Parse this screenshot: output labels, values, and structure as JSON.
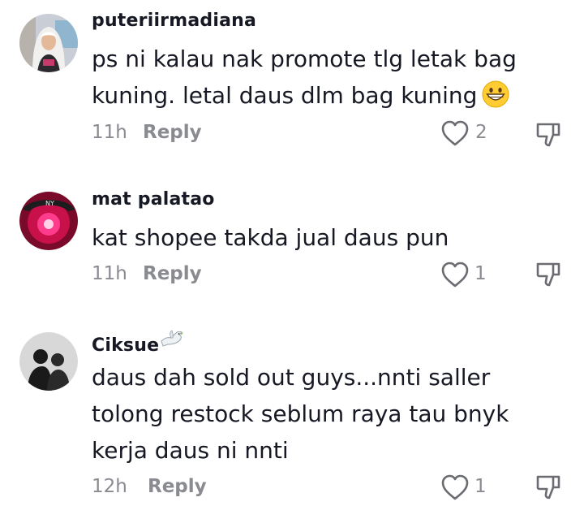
{
  "comments": [
    {
      "username": "puteriirmadiana",
      "text": "ps ni kalau nak promote tlg letak bag kuning. letal daus dlm bag kuning",
      "emoji": "grinning-face-emoji",
      "time": "11h",
      "reply_label": "Reply",
      "likes": "2"
    },
    {
      "username": "mat palatao",
      "text": "kat shopee takda jual daus pun",
      "time": "11h",
      "reply_label": "Reply",
      "likes": "1"
    },
    {
      "username": "Ciksue",
      "username_emoji": "dove-emoji",
      "text": "daus dah sold out guys...nnti saller tolong restock seblum raya tau bnyk kerja daus ni nnti",
      "time": "12h",
      "reply_label": "Reply",
      "likes": "1"
    }
  ],
  "icons": {
    "like": "heart-outline-icon",
    "dislike": "thumbs-down-outline-icon"
  },
  "colors": {
    "text_primary": "#161823",
    "text_secondary": "#8a8b91",
    "background": "#ffffff"
  }
}
